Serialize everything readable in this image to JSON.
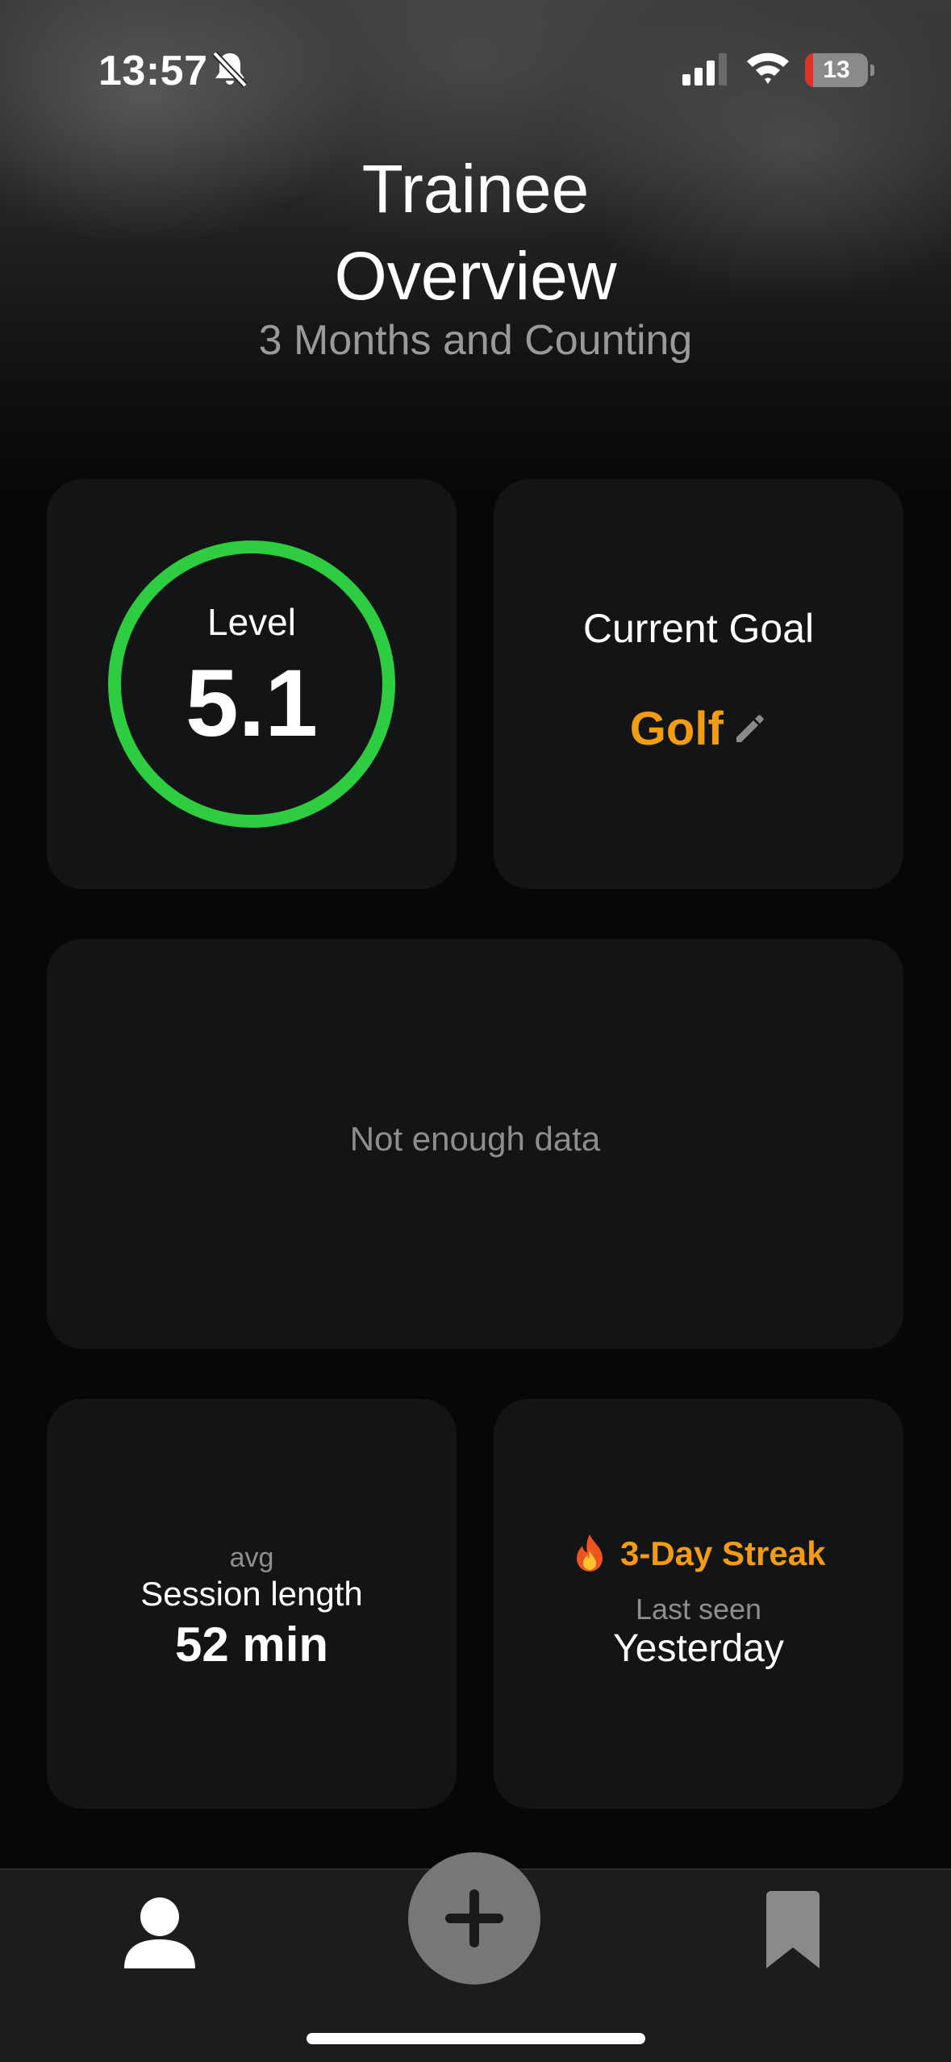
{
  "status_bar": {
    "time": "13:57",
    "silent_icon": "bell-slash-icon",
    "signal_icon": "cellular-signal-icon",
    "wifi_icon": "wifi-icon",
    "battery_level": "13",
    "battery_color": "#e0312d"
  },
  "header": {
    "title_line1": "Trainee",
    "title_line2": "Overview",
    "subtitle": "3 Months and Counting"
  },
  "level_card": {
    "label": "Level",
    "value": "5.1",
    "ring_color": "#2ecc40"
  },
  "goal_card": {
    "label": "Current Goal",
    "value": "Golf",
    "value_color": "#f39c12",
    "edit_icon": "pencil-icon"
  },
  "chart_card": {
    "empty_message": "Not enough data"
  },
  "session_card": {
    "qualifier": "avg",
    "label": "Session length",
    "value": "52 min"
  },
  "streak_card": {
    "icon": "fire-icon",
    "streak": "3-Day Streak",
    "last_seen_label": "Last seen",
    "last_seen_value": "Yesterday",
    "accent_color": "#f39c12"
  },
  "tab_bar": {
    "items": [
      {
        "name": "profile",
        "icon": "person-icon"
      },
      {
        "name": "add",
        "icon": "plus-icon"
      },
      {
        "name": "saved",
        "icon": "bookmark-icon"
      }
    ]
  }
}
